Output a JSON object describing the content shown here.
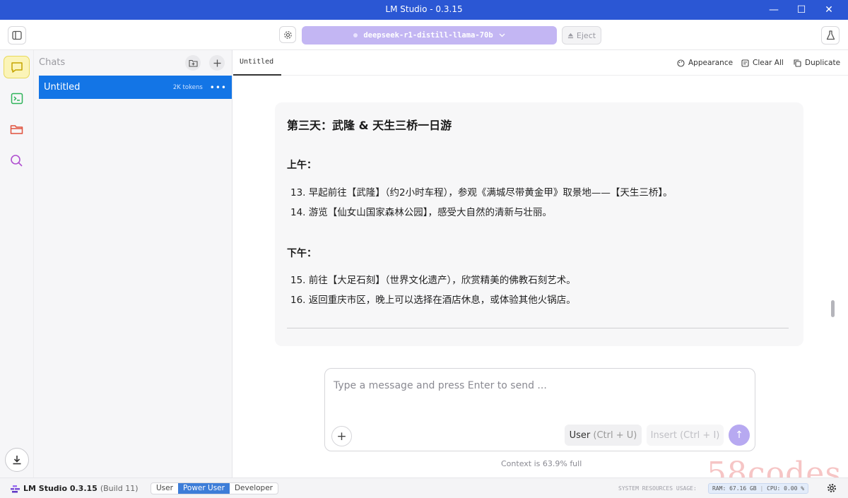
{
  "window": {
    "title": "LM Studio - 0.3.15",
    "min_glyph": "—",
    "max_glyph": "☐",
    "close_glyph": "✕"
  },
  "toolbar": {
    "model_name": "deepseek-r1-distill-llama-70b",
    "eject_label": "Eject"
  },
  "chats": {
    "title": "Chats",
    "items": [
      {
        "name": "Untitled",
        "tokens": "2K tokens",
        "more": "•••"
      }
    ]
  },
  "tabs": [
    {
      "label": "Untitled"
    }
  ],
  "tab_actions": {
    "appearance": "Appearance",
    "clear_all": "Clear All",
    "duplicate": "Duplicate"
  },
  "message": {
    "heading": "第三天：武隆 & 天生三桥一日游",
    "morning_label": "上午：",
    "morning_items": [
      "13. 早起前往【武隆】（约2小时车程），参观《满城尽带黄金甲》取景地——【天生三桥】。",
      "14. 游览【仙女山国家森林公园】，感受大自然的清新与壮丽。"
    ],
    "afternoon_label": "下午：",
    "afternoon_items": [
      "15. 前往【大足石刻】（世界文化遗产），欣赏精美的佛教石刻艺术。",
      "16. 返回重庆市区，晚上可以选择在酒店休息，或体验其他火锅店。"
    ]
  },
  "composer": {
    "placeholder": "Type a message and press Enter to send ...",
    "user_label": "User",
    "user_shortcut": "(Ctrl + U)",
    "insert_label": "Insert",
    "insert_shortcut": "(Ctrl + I)",
    "plus": "+",
    "send": "↑"
  },
  "context": "Context is 63.9% full",
  "statusbar": {
    "app_name": "LM Studio 0.3.15",
    "build": "(Build 11)",
    "modes": [
      "User",
      "Power User",
      "Developer"
    ],
    "active_mode": "Power User",
    "sys_label": "SYSTEM RESOURCES USAGE:",
    "ram": "RAM: 67.16 GB",
    "cpu": "CPU: 0.00 %"
  },
  "watermark": "58codes",
  "colors": {
    "titlebar": "#2b57d4",
    "model_pill": "#c3b6f3",
    "selected_chat": "#1375e6",
    "active_rail": "#fbf4b8",
    "send": "#b7a9f1"
  }
}
